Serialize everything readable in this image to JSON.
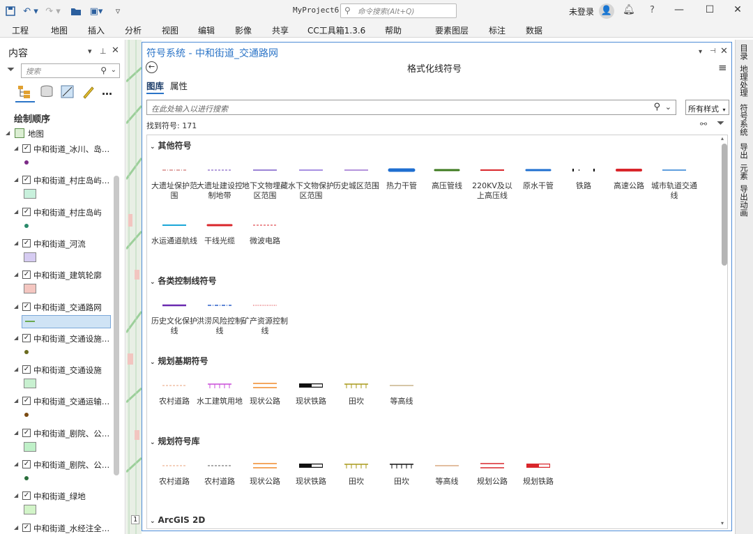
{
  "titlebar": {
    "project": "MyProject6",
    "command_search_placeholder": "命令搜索(Alt+Q)",
    "user": "未登录"
  },
  "ribbon": {
    "tabs": [
      "工程",
      "地图",
      "插入",
      "分析",
      "视图",
      "编辑",
      "影像",
      "共享",
      "CC工具箱1.3.6",
      "帮助",
      "要素图层",
      "标注",
      "数据"
    ]
  },
  "contents": {
    "title": "内容",
    "search_placeholder": "搜索",
    "draw_order": "绘制顺序",
    "map": "地图",
    "layers": [
      {
        "name": "中和街道_冰川、岛…",
        "sym": "dot",
        "color": "#7b2a86"
      },
      {
        "name": "中和街道_村庄岛屿…",
        "sym": "fill",
        "color": "#c8f0dc"
      },
      {
        "name": "中和街道_村庄岛屿",
        "sym": "dot",
        "color": "#2a8a6a"
      },
      {
        "name": "中和街道_河流",
        "sym": "fill",
        "color": "#d6ccf2"
      },
      {
        "name": "中和街道_建筑轮廓",
        "sym": "fill",
        "color": "#f4c6c0"
      },
      {
        "name": "中和街道_交通路网",
        "sym": "line",
        "color": "#6aa84f"
      },
      {
        "name": "中和街道_交通设施…",
        "sym": "dot",
        "color": "#6b6b1f"
      },
      {
        "name": "中和街道_交通设施",
        "sym": "fill",
        "color": "#c8f0d0"
      },
      {
        "name": "中和街道_交通运输…",
        "sym": "dot",
        "color": "#7a4a12"
      },
      {
        "name": "中和街道_剧院、公…",
        "sym": "fill",
        "color": "#bff0c8"
      },
      {
        "name": "中和街道_剧院、公…",
        "sym": "dot",
        "color": "#2a6e3c"
      },
      {
        "name": "中和街道_绿地",
        "sym": "fill",
        "color": "#d2f4c8"
      },
      {
        "name": "中和街道_水经注全…",
        "sym": "none",
        "color": ""
      }
    ]
  },
  "symbology": {
    "title": "符号系统 - 中和街道_交通路网",
    "subtitle": "格式化线符号",
    "tabs": [
      "图库",
      "属性"
    ],
    "search_placeholder": "在此处输入以进行搜索",
    "style_filter": "所有样式",
    "found": "找到符号: 171",
    "categories": [
      {
        "name": "其他符号",
        "items": [
          {
            "label": "大遗址保护范围",
            "color": "#c0504d",
            "style": "dashdot",
            "width": 1
          },
          {
            "label": "大遗址建设控制地带",
            "color": "#6a3db8",
            "style": "dashed",
            "width": 1
          },
          {
            "label": "地下文物埋藏区范围",
            "color": "#7a5ac8",
            "style": "solid",
            "width": 1.5
          },
          {
            "label": "水下文物保护区范围",
            "color": "#8a6ad8",
            "style": "solid",
            "width": 1.5
          },
          {
            "label": "历史城区范围",
            "color": "#9b6fd0",
            "style": "solid",
            "width": 1.5
          },
          {
            "label": "热力干管",
            "color": "#1f6fd0",
            "style": "solid",
            "width": 5
          },
          {
            "label": "高压管线",
            "color": "#3d7a1f",
            "style": "solid",
            "width": 3
          },
          {
            "label": "220KV及以上高压线",
            "color": "#d9262b",
            "style": "solid",
            "width": 2
          },
          {
            "label": "原水干管",
            "color": "#1f6fd0",
            "style": "solid",
            "width": 3
          },
          {
            "label": "铁路",
            "color": "#111111",
            "style": "railway",
            "width": 2
          },
          {
            "label": "高速公路",
            "color": "#d9262b",
            "style": "solid",
            "width": 4
          },
          {
            "label": "城市轨道交通线",
            "color": "#2a7fd4",
            "style": "solid",
            "width": 1.5
          },
          {
            "label": "水运通道航线",
            "color": "#1aa7d8",
            "style": "solid",
            "width": 2
          },
          {
            "label": "干线光缆",
            "color": "#d9262b",
            "style": "solid",
            "width": 3
          },
          {
            "label": "微波电路",
            "color": "#d9262b",
            "style": "dashed",
            "width": 1
          }
        ]
      },
      {
        "name": "各类控制线符号",
        "items": [
          {
            "label": "历史文化保护线",
            "color": "#6a2ab0",
            "style": "solid",
            "width": 2.5
          },
          {
            "label": "洪涝风险控制线",
            "color": "#2a5fc8",
            "style": "dashdot",
            "width": 1.5
          },
          {
            "label": "矿产资源控制线",
            "color": "#d9262b",
            "style": "dotted",
            "width": 1
          }
        ]
      },
      {
        "name": "规划基期符号",
        "items": [
          {
            "label": "农村道路",
            "color": "#e8a27a",
            "style": "dashed",
            "width": 1
          },
          {
            "label": "水工建筑用地",
            "color": "#c84bd8",
            "style": "ticked",
            "width": 1.5
          },
          {
            "label": "现状公路",
            "color": "#f08a2a",
            "style": "double",
            "width": 1.5
          },
          {
            "label": "现状铁路",
            "color": "#111111",
            "style": "rail2",
            "width": 2
          },
          {
            "label": "田坎",
            "color": "#a89a1a",
            "style": "ticked",
            "width": 1.5
          },
          {
            "label": "等高线",
            "color": "#c8b48a",
            "style": "solid",
            "width": 1.5
          }
        ]
      },
      {
        "name": "规划符号库",
        "items": [
          {
            "label": "农村道路",
            "color": "#e8a27a",
            "style": "dashed",
            "width": 1
          },
          {
            "label": "农村道路",
            "color": "#555555",
            "style": "dashed",
            "width": 1
          },
          {
            "label": "现状公路",
            "color": "#f08a2a",
            "style": "double",
            "width": 1.5
          },
          {
            "label": "现状铁路",
            "color": "#111111",
            "style": "rail2",
            "width": 2
          },
          {
            "label": "田坎",
            "color": "#a89a1a",
            "style": "ticked",
            "width": 1.5
          },
          {
            "label": "田坎",
            "color": "#111111",
            "style": "ticked",
            "width": 1.5
          },
          {
            "label": "等高线",
            "color": "#d8a880",
            "style": "solid",
            "width": 1.5
          },
          {
            "label": "规划公路",
            "color": "#d9262b",
            "style": "double",
            "width": 1.5
          },
          {
            "label": "规划铁路",
            "color": "#d9262b",
            "style": "rail2",
            "width": 2
          }
        ]
      },
      {
        "name": "ArcGIS 2D",
        "items": []
      }
    ]
  },
  "right_dock": {
    "tabs": [
      "目录",
      "地理处理",
      "符号系统",
      "导出",
      "元素",
      "导出动画"
    ]
  },
  "map_strip": {
    "scale_label": "1"
  }
}
